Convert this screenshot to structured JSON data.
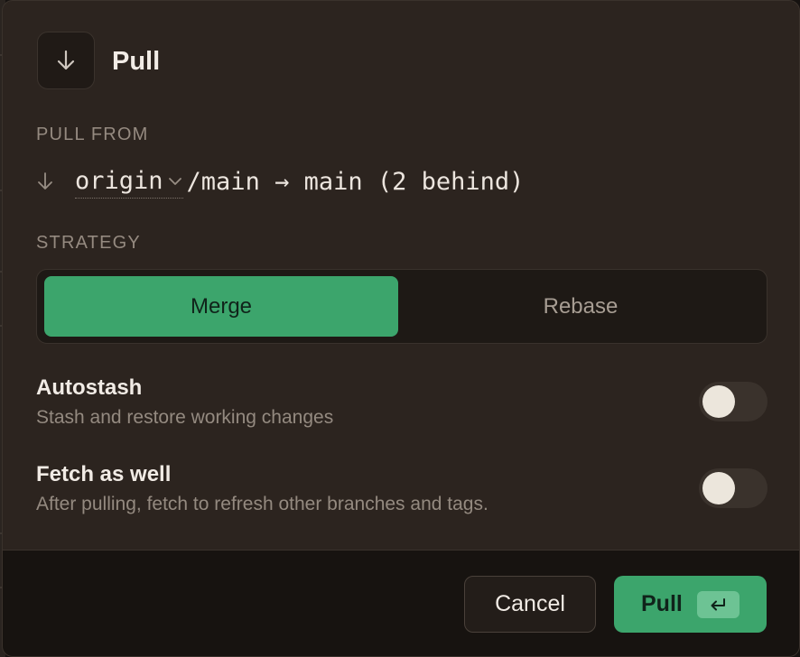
{
  "dialog": {
    "title": "Pull",
    "icon": "arrow-down-icon"
  },
  "pull_from": {
    "label": "PULL FROM",
    "remote": "origin",
    "rest": "/main → main (2 behind)"
  },
  "strategy": {
    "label": "STRATEGY",
    "options": [
      {
        "label": "Merge",
        "selected": true
      },
      {
        "label": "Rebase",
        "selected": false
      }
    ]
  },
  "options": {
    "autostash": {
      "title": "Autostash",
      "description": "Stash and restore working changes",
      "enabled": false
    },
    "fetch": {
      "title": "Fetch as well",
      "description": "After pulling, fetch to refresh other branches and tags.",
      "enabled": false
    }
  },
  "footer": {
    "cancel_label": "Cancel",
    "pull_label": "Pull",
    "pull_shortcut_icon": "return-key-icon"
  },
  "colors": {
    "accent": "#3ca56c",
    "dialog_bg": "#2c241f",
    "footer_bg": "#171310"
  }
}
